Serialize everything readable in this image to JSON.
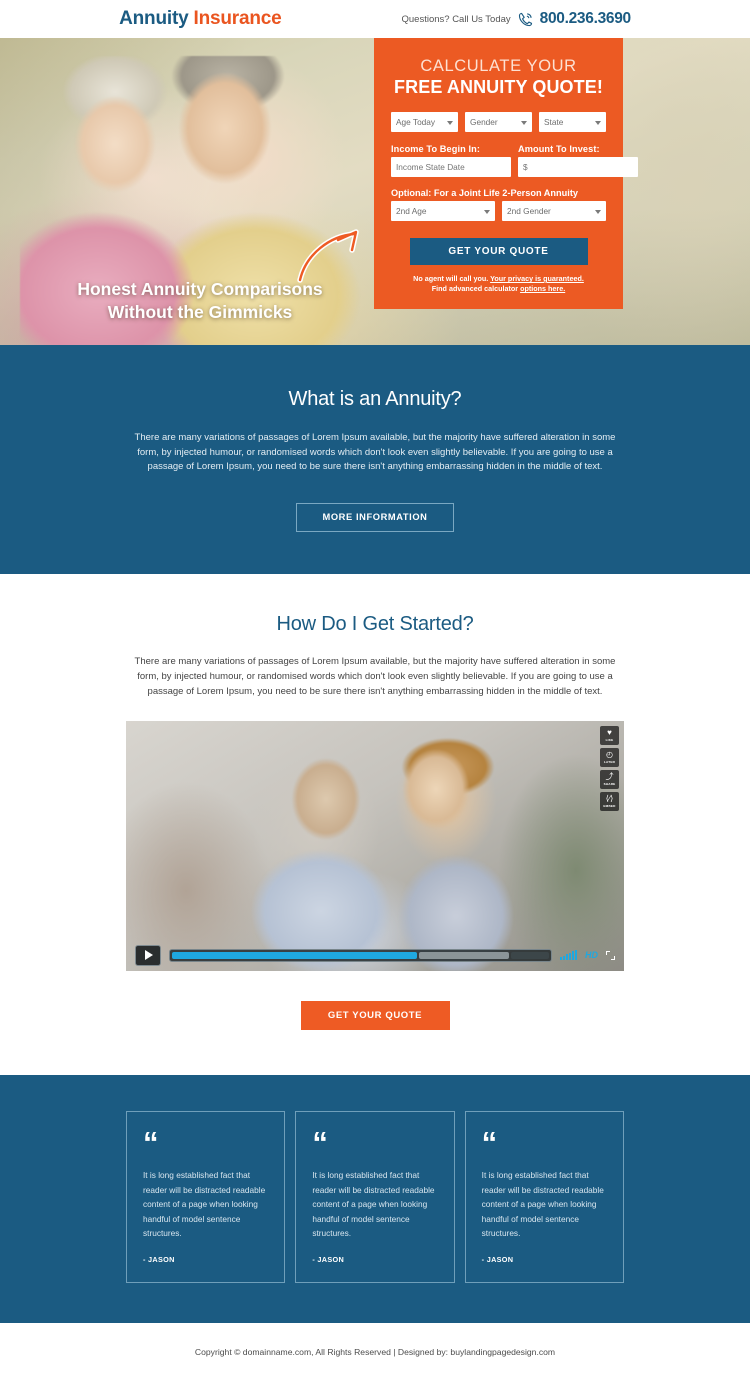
{
  "header": {
    "logo_primary": "Annuity",
    "logo_secondary": "Insurance",
    "questions_label": "Questions? Call Us Today",
    "phone": "800.236.3690",
    "phone_icon": "phone-call-icon"
  },
  "hero": {
    "headline_line1": "Honest Annuity Comparisons",
    "headline_line2": "Without the Gimmicks",
    "arrow_icon": "curved-arrow-icon"
  },
  "quote_form": {
    "title_line1": "CALCULATE YOUR",
    "title_line2": "FREE ANNUITY QUOTE!",
    "age_today": "Age Today",
    "gender": "Gender",
    "state": "State",
    "income_begin_label": "Income To Begin In:",
    "income_begin_placeholder": "Income State Date",
    "amount_invest_label": "Amount To Invest:",
    "amount_invest_placeholder": "$",
    "optional_label": "Optional: For a Joint Life 2-Person Annuity",
    "second_age": "2nd Age",
    "second_gender": "2nd Gender",
    "submit_label": "GET YOUR QUOTE",
    "fine_line1_a": "No agent will call you. ",
    "fine_line1_b": "Your privacy is guaranteed.",
    "fine_line2_a": "Find advanced calculator ",
    "fine_line2_b": "options here."
  },
  "annuity_section": {
    "title": "What is an Annuity?",
    "body": "There are many variations of passages of Lorem Ipsum available, but the majority have suffered alteration in some form, by injected humour, or randomised words which don't look even slightly believable. If you are going to use a passage of Lorem Ipsum, you need to be sure there isn't anything embarrassing hidden in the middle of text.",
    "button_label": "MORE INFORMATION"
  },
  "started_section": {
    "title": "How Do I Get Started?",
    "body": "There are many variations of passages of Lorem Ipsum available, but the majority have suffered alteration in some form, by injected humour, or randomised words which don't look even slightly believable. If you are going to use a passage of Lorem Ipsum, you need to be sure there isn't anything embarrassing hidden in the middle of text.",
    "button_label": "GET YOUR QUOTE"
  },
  "video": {
    "side_buttons": [
      {
        "icon": "heart-icon",
        "glyph": "♥",
        "label": "LIKE"
      },
      {
        "icon": "clock-icon",
        "glyph": "◴",
        "label": "LATER"
      },
      {
        "icon": "share-icon",
        "glyph": "⤴",
        "label": "SHARE"
      },
      {
        "icon": "embed-code-icon",
        "glyph": "⟨∕⟩",
        "label": "EMBED"
      }
    ],
    "play_icon": "play-icon",
    "progress_percent": 65,
    "quality_label": "HD",
    "volume_icon": "volume-bars-icon",
    "fullscreen_icon": "fullscreen-icon"
  },
  "testimonials": [
    {
      "quote_icon": "quote-mark-icon",
      "text": "It is long established fact that  reader will be distracted readable content of a page when looking handful of model sentence structures.",
      "author": "- JASON"
    },
    {
      "quote_icon": "quote-mark-icon",
      "text": "It is long established fact that  reader will be distracted readable content of a page when looking handful of model sentence structures.",
      "author": "- JASON"
    },
    {
      "quote_icon": "quote-mark-icon",
      "text": "It is long established fact that  reader will be distracted readable content of a page when looking handful of model sentence structures.",
      "author": "- JASON"
    }
  ],
  "footer": {
    "text": "Copyright © domainname.com, All Rights Reserved  |  Designed by: buylandingpagedesign.com"
  },
  "colors": {
    "brand_blue": "#1b5b82",
    "brand_orange": "#ec5a23",
    "cta_orange": "#ee5b24",
    "video_accent": "#1fa8e0"
  }
}
